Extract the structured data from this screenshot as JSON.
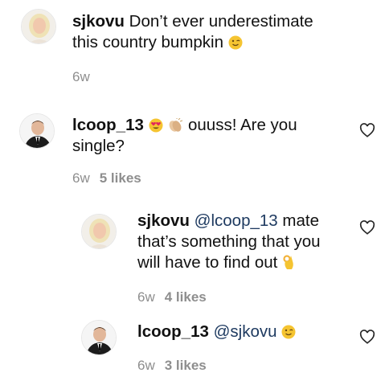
{
  "comments": [
    {
      "username": "sjkovu",
      "text": "Don’t ever underestimate this country bumpkin",
      "emoji": "wink-emoji",
      "age": "6w",
      "likes": ""
    },
    {
      "username": "lcoop_13",
      "emojis": [
        "heart-eyes-emoji",
        "clapping-hands-emoji"
      ],
      "text": "ouuss! Are you single?",
      "age": "6w",
      "likes": "5 likes"
    },
    {
      "username": "sjkovu",
      "mention": "@lcoop_13",
      "text": "mate that’s something that you will have to find out",
      "emoji": "ok-hand-emoji",
      "age": "6w",
      "likes": "4 likes"
    },
    {
      "username": "lcoop_13",
      "mention": "@sjkovu",
      "emoji": "wink-emoji",
      "age": "6w",
      "likes": "3 likes"
    }
  ],
  "colors": {
    "mention": "#1e3a60",
    "meta": "#8e8e8e",
    "emoji": "#f5c431"
  }
}
